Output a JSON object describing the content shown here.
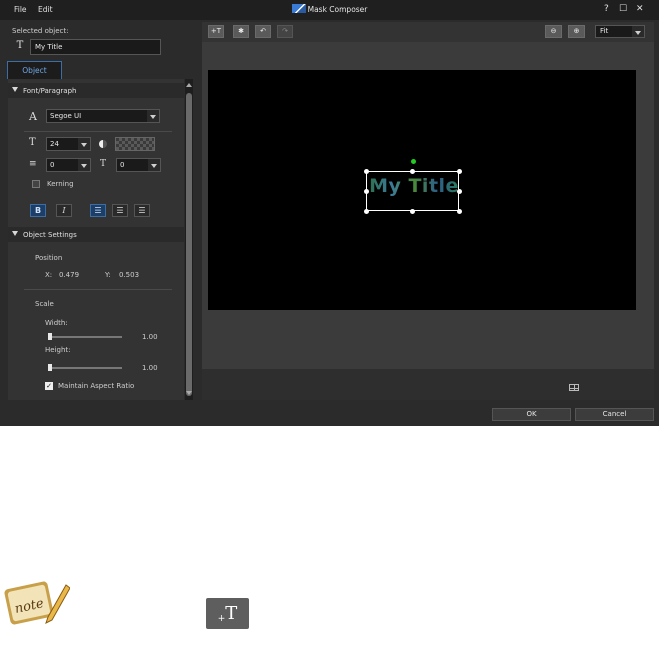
{
  "window": {
    "title": "Mask Composer",
    "menu": [
      "File",
      "Edit"
    ],
    "controls": {
      "help": "?",
      "maximize": "☐",
      "close": "✕"
    }
  },
  "left": {
    "selected_label": "Selected object:",
    "selected_value": "My Title",
    "tab": "Object",
    "font_section": "Font/Paragraph",
    "font_name": "Segoe UI",
    "font_size": "24",
    "line_spacing": "0",
    "char_spacing": "0",
    "kerning": "Kerning",
    "bold": "B",
    "italic": "I",
    "object_section": "Object Settings",
    "position_label": "Position",
    "x_label": "X:",
    "x_value": "0.479",
    "y_label": "Y:",
    "y_value": "0.503",
    "scale_label": "Scale",
    "width_label": "Width:",
    "width_value": "1.00",
    "height_label": "Height:",
    "height_value": "1.00",
    "aspect": "Maintain Aspect Ratio"
  },
  "right": {
    "zoom": "Fit",
    "canvas_text": "My Title"
  },
  "buttons": {
    "ok": "OK",
    "cancel": "Cancel"
  },
  "below": {
    "plus_t": "T"
  }
}
